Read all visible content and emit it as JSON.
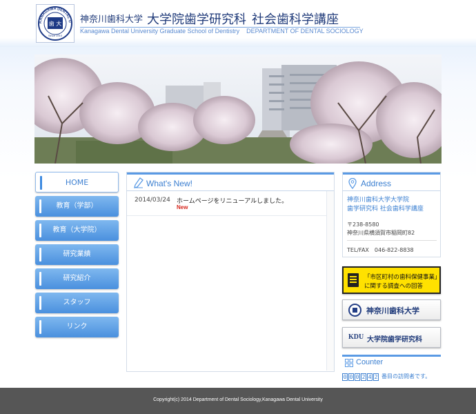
{
  "header": {
    "university": "神奈川歯科大学",
    "graduate_school": "大学院歯学研究科",
    "department": "社会歯科学講座",
    "subtitle_school": "Kanagawa Dental University Graduate School of Dentistry",
    "subtitle_department": "DEPARTMENT OF DENTAL SOCIOLOGY"
  },
  "logo": {
    "ring_text": "KANAGAWA DENTAL UNIVERSITY",
    "seal_text": "歯 大",
    "year_text": "Since 1910"
  },
  "nav": {
    "items": [
      {
        "label": "HOME"
      },
      {
        "label": "教育（学部）"
      },
      {
        "label": "教育（大学院）"
      },
      {
        "label": "研究業績"
      },
      {
        "label": "研究紹介"
      },
      {
        "label": "スタッフ"
      },
      {
        "label": "リンク"
      }
    ]
  },
  "news": {
    "title": "What's New!",
    "items": [
      {
        "date": "2014/03/24",
        "text": "ホームページをリニューアルしました。",
        "badge": "New"
      }
    ]
  },
  "address": {
    "title": "Address",
    "name_line1": "神奈川歯科大学大学院",
    "name_line2": "歯学研究科 社会歯科学講座",
    "postal": "〒238-8580",
    "street": "神奈川県横須賀市稲岡町82",
    "tel": "TEL/FAX　046-822-8838"
  },
  "banners": {
    "survey_line1": "「市区町村の歯科保健事業」",
    "survey_line2": "に関する調査への回答",
    "university": "神奈川歯科大学",
    "grad_prefix": "KDU",
    "grad_label": "大学院歯学研究科"
  },
  "counter": {
    "title": "Counter",
    "digits": [
      "0",
      "0",
      "0",
      "2",
      "4",
      "2"
    ],
    "suffix": "番目の訪問者です。"
  },
  "footer": {
    "copyright": "Copyright(c) 2014 Department of Dental Sociology,Kanagawa Dental University"
  },
  "colors": {
    "accent": "#3b7fd0",
    "nav_button": "#4a90de",
    "new_badge": "#d6251b",
    "footer_bg": "#565656",
    "survey_banner": "#ffe100"
  }
}
